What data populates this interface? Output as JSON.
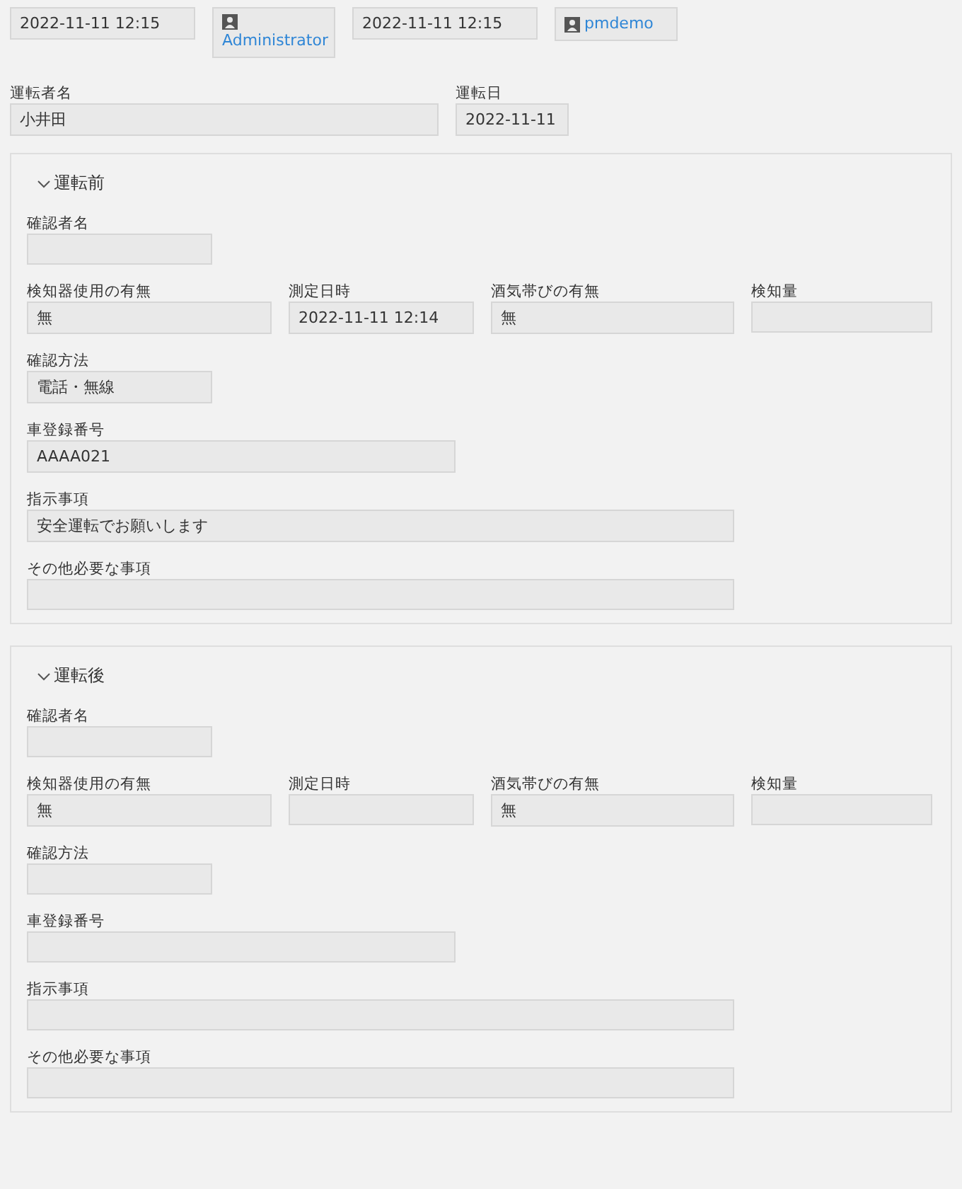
{
  "header": [
    {
      "kind": "datetime",
      "value": "2022-11-11 12:15"
    },
    {
      "kind": "user",
      "name": "Administrator"
    },
    {
      "kind": "datetime",
      "value": "2022-11-11 12:15"
    },
    {
      "kind": "user",
      "name": "pmdemo"
    }
  ],
  "driver": [
    {
      "label": "運転者名",
      "value": "小井田"
    },
    {
      "label": "運転日",
      "value": "2022-11-11"
    }
  ],
  "sections": [
    {
      "title": "運転前",
      "expanded": true,
      "fields": [
        {
          "label": "確認者名"
        },
        {
          "label": "検知器使用の有無",
          "value": "無"
        },
        {
          "label": "測定日時",
          "value": "2022-11-11 12:14"
        },
        {
          "label": "酒気帯びの有無",
          "value": "無"
        },
        {
          "label": "検知量"
        },
        {
          "label": "確認方法",
          "value": "電話・無線"
        },
        {
          "label": "車登録番号",
          "value": "AAAA021"
        },
        {
          "label": "指示事項",
          "value": "安全運転でお願いします"
        },
        {
          "label": "その他必要な事項"
        }
      ]
    },
    {
      "title": "運転後",
      "expanded": true,
      "fields": [
        {
          "label": "確認者名"
        },
        {
          "label": "検知器使用の有無",
          "value": "無"
        },
        {
          "label": "測定日時"
        },
        {
          "label": "酒気帯びの有無",
          "value": "無"
        },
        {
          "label": "検知量"
        },
        {
          "label": "確認方法"
        },
        {
          "label": "車登録番号"
        },
        {
          "label": "指示事項"
        },
        {
          "label": "その他必要な事項"
        }
      ]
    }
  ]
}
